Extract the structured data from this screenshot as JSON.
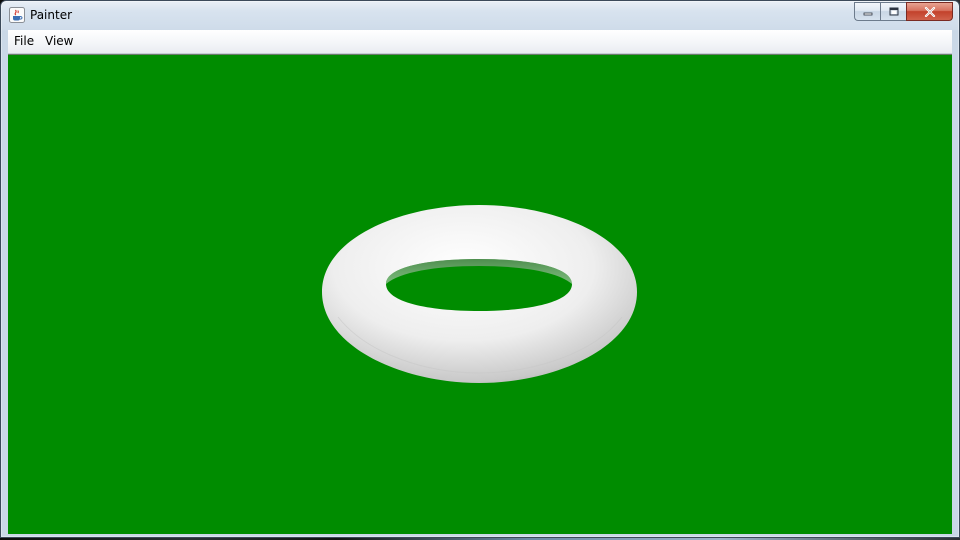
{
  "window": {
    "title": "Painter",
    "icon": "java-cup-icon"
  },
  "caption_buttons": {
    "minimize_icon": "minimize-icon",
    "maximize_icon": "maximize-icon",
    "close_icon": "close-icon"
  },
  "menubar": {
    "items": [
      {
        "label": "File"
      },
      {
        "label": "View"
      }
    ]
  },
  "canvas": {
    "background_color": "#008c00",
    "object": "torus",
    "object_color": "#f2f2f2"
  }
}
